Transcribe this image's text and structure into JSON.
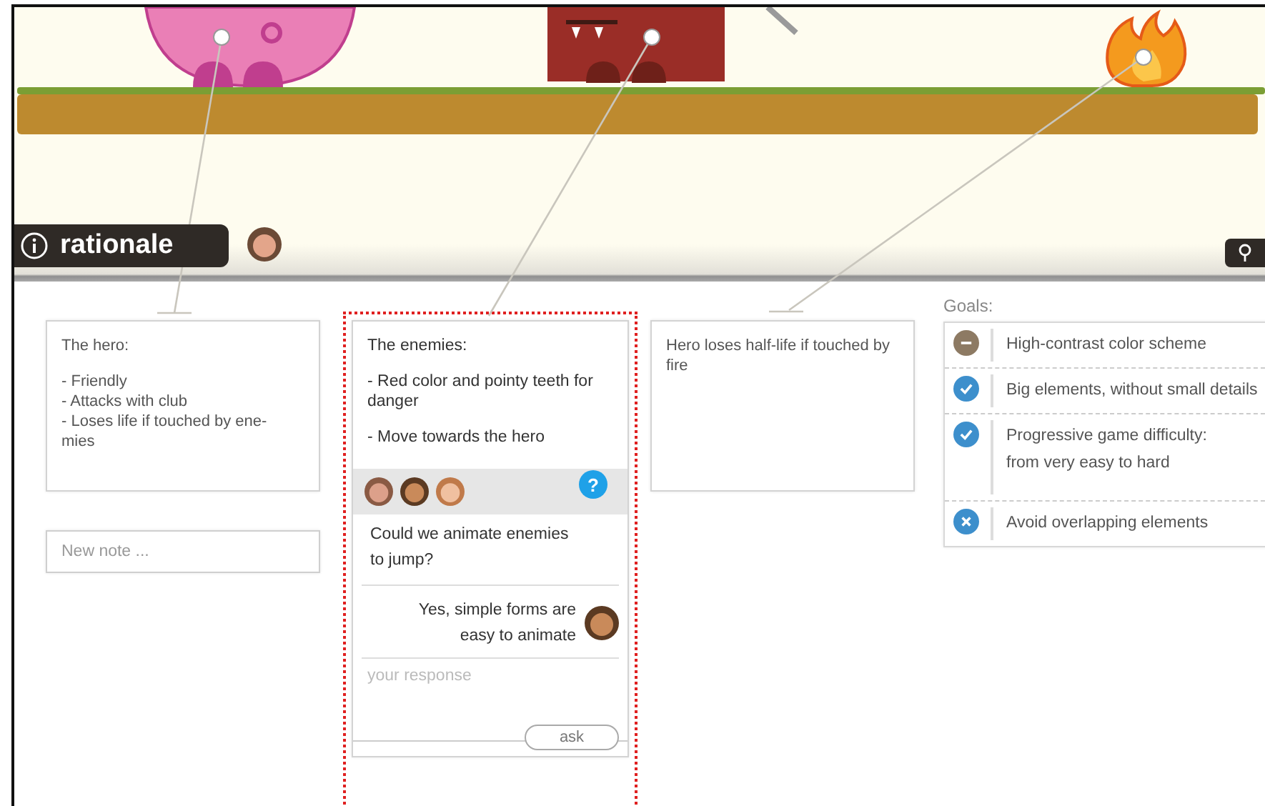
{
  "rationale_tab": {
    "label": "rationale"
  },
  "columns": [
    {
      "notes": [
        {
          "paragraphs": [
            "The hero:",
            "- Friendly\n- Attacks with club\n- Loses life if touched by ene-\nmies"
          ],
          "selected": false
        }
      ],
      "new_note": {
        "placeholder": "New note ..."
      }
    },
    {
      "notes": [
        {
          "paragraphs": [
            "The enemies:",
            "- Red color and pointy teeth for danger",
            "- Move towards the hero"
          ],
          "selected": true,
          "discussion": {
            "badge": "?",
            "messages": [
              {
                "kind": "question",
                "text": "Could we animate enemies to jump?"
              },
              {
                "kind": "reply",
                "text": "Yes, simple forms are easy to animate"
              }
            ],
            "response": {
              "placeholder": "your response"
            },
            "ask": "ask"
          }
        }
      ]
    },
    {
      "notes": [
        {
          "paragraphs": [
            "Hero loses half-life if touched by fire"
          ],
          "selected": false
        }
      ]
    }
  ],
  "goals": {
    "label": "Goals:",
    "items": [
      {
        "kind": "neutral",
        "text": "High-contrast color scheme"
      },
      {
        "kind": "done",
        "text": "Big elements, without small details"
      },
      {
        "kind": "done",
        "text": "Progressive game difficulty:\nfrom very easy to hard"
      },
      {
        "kind": "rejected",
        "text": "Avoid overlapping elements"
      }
    ]
  }
}
